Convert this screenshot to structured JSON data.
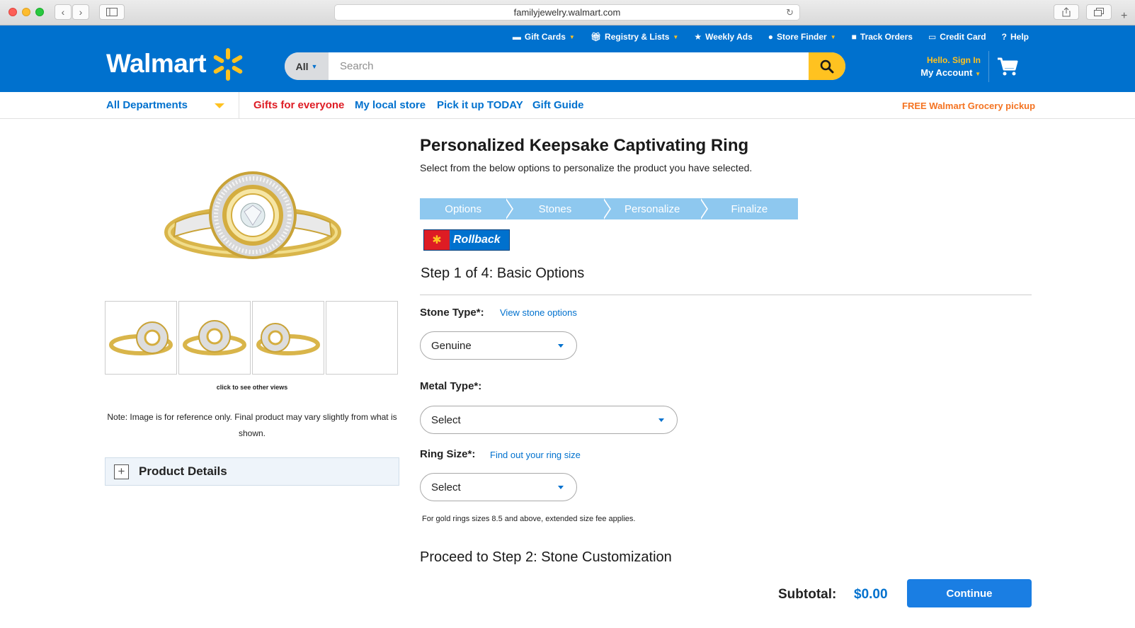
{
  "browser": {
    "url": "familyjewelry.walmart.com"
  },
  "header": {
    "logo": "Walmart",
    "utility": [
      {
        "label": "Gift Cards",
        "icon": "card-icon",
        "caret": true
      },
      {
        "label": "Registry & Lists",
        "icon": "gift-icon",
        "caret": true
      },
      {
        "label": "Weekly Ads",
        "icon": "star-icon",
        "caret": false
      },
      {
        "label": "Store Finder",
        "icon": "location-pin-icon",
        "caret": true
      },
      {
        "label": "Track Orders",
        "icon": "box-icon",
        "caret": false
      },
      {
        "label": "Credit Card",
        "icon": "credit-card-icon",
        "caret": false
      },
      {
        "label": "Help",
        "icon": "help-icon",
        "caret": false
      }
    ],
    "search": {
      "dept": "All",
      "placeholder": "Search"
    },
    "account": {
      "hello": "Hello. Sign In",
      "my": "My Account"
    }
  },
  "nav": {
    "departments": "All Departments",
    "links": [
      "Gifts for everyone",
      "My local store",
      "Pick it up TODAY",
      "Gift Guide"
    ],
    "promo": "FREE Walmart Grocery pickup"
  },
  "gallery": {
    "click_views": "click to see other views",
    "note": "Note: Image is for reference only. Final product may vary slightly from what is shown.",
    "product_details": "Product Details"
  },
  "product": {
    "title": "Personalized Keepsake Captivating Ring",
    "subtitle": "Select from the below options to personalize the product you have selected.",
    "steps": [
      "Options",
      "Stones",
      "Personalize",
      "Finalize"
    ],
    "rollback": "Rollback",
    "step_heading": "Step 1 of 4: Basic Options",
    "stone_type": {
      "label": "Stone Type*:",
      "link": "View stone options",
      "value": "Genuine"
    },
    "metal_type": {
      "label": "Metal Type*:",
      "value": "Select"
    },
    "ring_size": {
      "label": "Ring Size*:",
      "link": "Find out your ring size",
      "value": "Select"
    },
    "size_note": "For gold rings sizes 8.5 and above, extended size fee applies.",
    "proceed": "Proceed to Step 2: Stone Customization",
    "subtotal_label": "Subtotal:",
    "subtotal_value": "$0.00",
    "continue": "Continue"
  },
  "colors": {
    "brand_blue": "#0071ce",
    "spark_yellow": "#ffc220",
    "step_blue": "#8ec8ef",
    "link_red": "#de1c24",
    "promo_orange": "#f47321"
  }
}
